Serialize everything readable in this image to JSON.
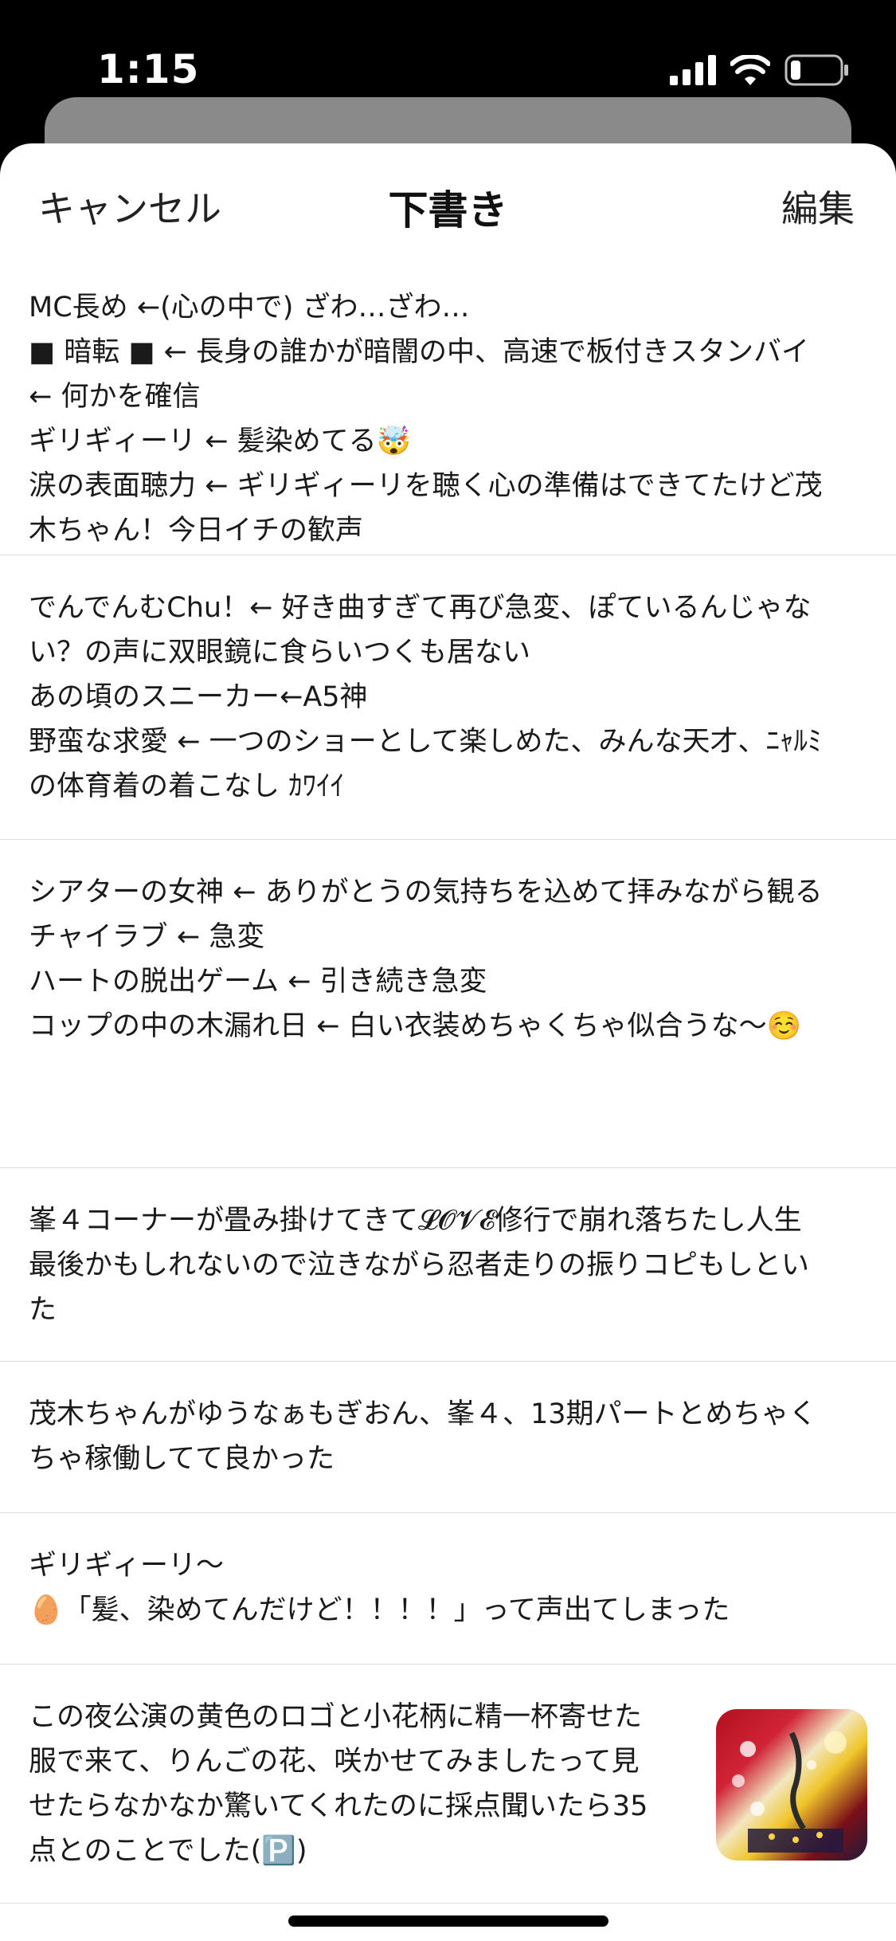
{
  "status_bar": {
    "time": "1:15"
  },
  "nav": {
    "cancel_label": "キャンセル",
    "title": "下書き",
    "edit_label": "編集"
  },
  "drafts": [
    {
      "lines": [
        "MC長め ←(心の中で) ざわ…ざわ…",
        "■ 暗転 ■ ← 長身の誰かが暗闇の中、高速で板付きスタンバイ",
        "← 何かを確信",
        "ギリギィーリ ← 髪染めてる🤯",
        "涙の表面聴力 ← ギリギィーリを聴く心の準備はできてたけど茂",
        "木ちゃん！今日イチの歓声"
      ]
    },
    {
      "lines": [
        "でんでんむChu！← 好き曲すぎて再び急変、ぽているんじゃな",
        "い？の声に双眼鏡に食らいつくも居ない",
        "あの頃のスニーカー←A5神",
        "野蛮な求愛 ← 一つのショーとして楽しめた、みんな天才、ﾆｬﾙﾐ",
        "の体育着の着こなし ｶﾜｲｲ"
      ]
    },
    {
      "lines": [
        "シアターの女神 ← ありがとうの気持ちを込めて拝みながら観る",
        "チャイラブ ← 急変",
        "ハートの脱出ゲーム ← 引き続き急変",
        "コップの中の木漏れ日 ← 白い衣装めちゃくちゃ似合うな〜☺️"
      ]
    },
    {
      "lines": [
        "峯４コーナーが畳み掛けてきて𝓛𝓞𝓥𝓔修行で崩れ落ちたし人生",
        "最後かもしれないので泣きながら忍者走りの振りコピもしとい",
        "た"
      ]
    },
    {
      "lines": [
        "茂木ちゃんがゆうなぁもぎおん、峯４、13期パートとめちゃく",
        "ちゃ稼働してて良かった"
      ]
    },
    {
      "lines": [
        "ギリギィーリ〜",
        "🥚「髪、染めてんだけど！！！！」って声出てしまった"
      ]
    },
    {
      "lines": [
        "この夜公演の黄色のロゴと小花柄に精一杯寄せた",
        "服で来て、りんごの花、咲かせてみましたって見",
        "せたらなかなか驚いてくれたのに採点聞いたら35",
        "点とのことでした(🅿️)"
      ]
    }
  ],
  "colors": {
    "sheet_bg": "#ffffff",
    "divider": "#dcdcdc",
    "backdrop": "#000000"
  }
}
